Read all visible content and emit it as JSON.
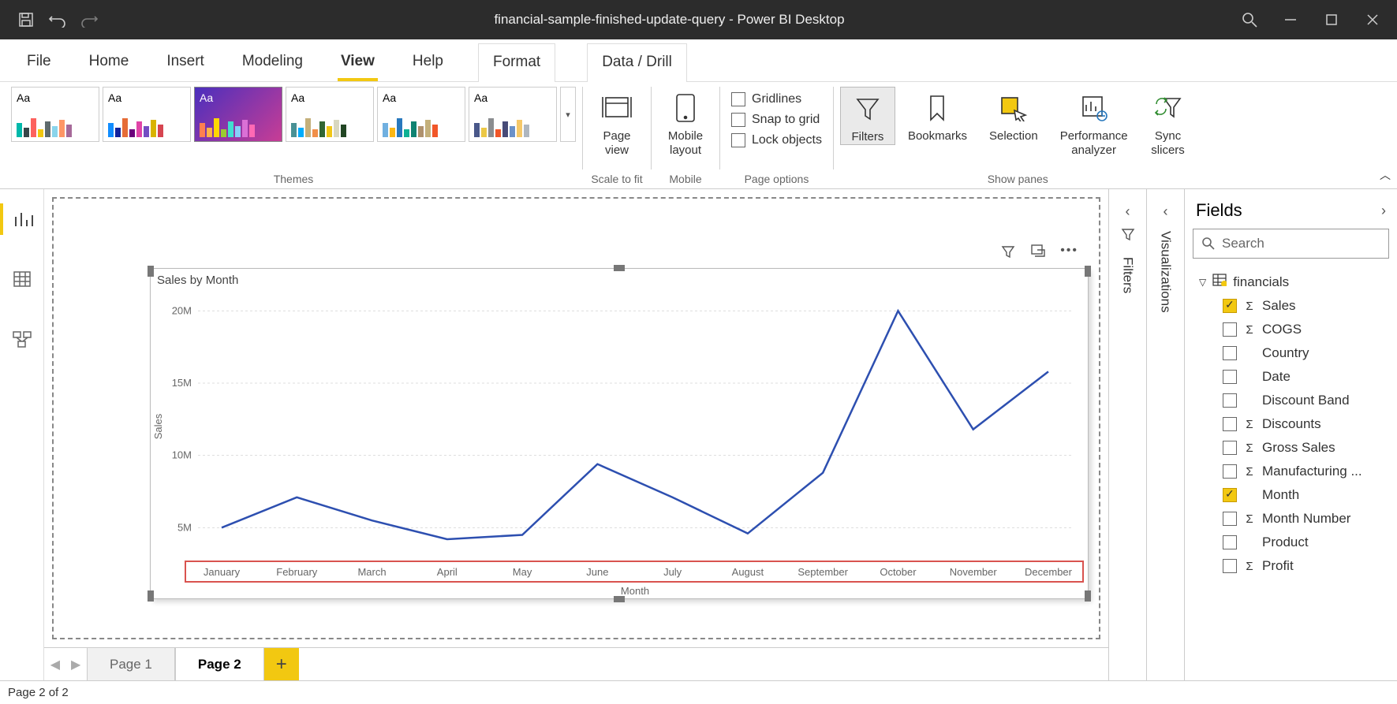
{
  "titlebar": {
    "title": "financial-sample-finished-update-query - Power BI Desktop"
  },
  "menu": {
    "file": "File",
    "home": "Home",
    "insert": "Insert",
    "modeling": "Modeling",
    "view": "View",
    "help": "Help",
    "format": "Format",
    "drill": "Data / Drill"
  },
  "ribbon": {
    "themes_label": "Themes",
    "scale_label": "Scale to fit",
    "page_view": "Page\nview",
    "mobile_layout": "Mobile\nlayout",
    "mobile_label": "Mobile",
    "gridlines": "Gridlines",
    "snap": "Snap to grid",
    "lock": "Lock objects",
    "page_options_label": "Page options",
    "filters": "Filters",
    "bookmarks": "Bookmarks",
    "selection": "Selection",
    "perf": "Performance\nanalyzer",
    "sync": "Sync\nslicers",
    "show_panes_label": "Show panes"
  },
  "tabs": {
    "page1": "Page 1",
    "page2": "Page 2"
  },
  "status": {
    "text": "Page 2 of 2"
  },
  "panes": {
    "filters": "Filters",
    "visualizations": "Visualizations",
    "fields": "Fields",
    "search_placeholder": "Search"
  },
  "fields_table": {
    "name": "financials",
    "items": [
      {
        "label": "Sales",
        "checked": true,
        "sigma": true
      },
      {
        "label": "COGS",
        "checked": false,
        "sigma": true
      },
      {
        "label": "Country",
        "checked": false,
        "sigma": false
      },
      {
        "label": "Date",
        "checked": false,
        "sigma": false
      },
      {
        "label": "Discount Band",
        "checked": false,
        "sigma": false
      },
      {
        "label": "Discounts",
        "checked": false,
        "sigma": true
      },
      {
        "label": "Gross Sales",
        "checked": false,
        "sigma": true
      },
      {
        "label": "Manufacturing ...",
        "checked": false,
        "sigma": true
      },
      {
        "label": "Month",
        "checked": true,
        "sigma": false
      },
      {
        "label": "Month Number",
        "checked": false,
        "sigma": true
      },
      {
        "label": "Product",
        "checked": false,
        "sigma": false
      },
      {
        "label": "Profit",
        "checked": false,
        "sigma": true
      }
    ]
  },
  "chart_data": {
    "type": "line",
    "title": "Sales by Month",
    "xlabel": "Month",
    "ylabel": "Sales",
    "categories": [
      "January",
      "February",
      "March",
      "April",
      "May",
      "June",
      "July",
      "August",
      "September",
      "October",
      "November",
      "December"
    ],
    "values": [
      5000000,
      7100000,
      5500000,
      4200000,
      4500000,
      9400000,
      7100000,
      4600000,
      8800000,
      20000000,
      11800000,
      15800000
    ],
    "y_ticks": [
      5000000,
      10000000,
      15000000,
      20000000
    ],
    "y_tick_labels": [
      "5M",
      "10M",
      "15M",
      "20M"
    ],
    "ylim": [
      3000000,
      21000000
    ]
  },
  "colors": {
    "accent": "#f2c811",
    "line": "#2d4fb0"
  }
}
